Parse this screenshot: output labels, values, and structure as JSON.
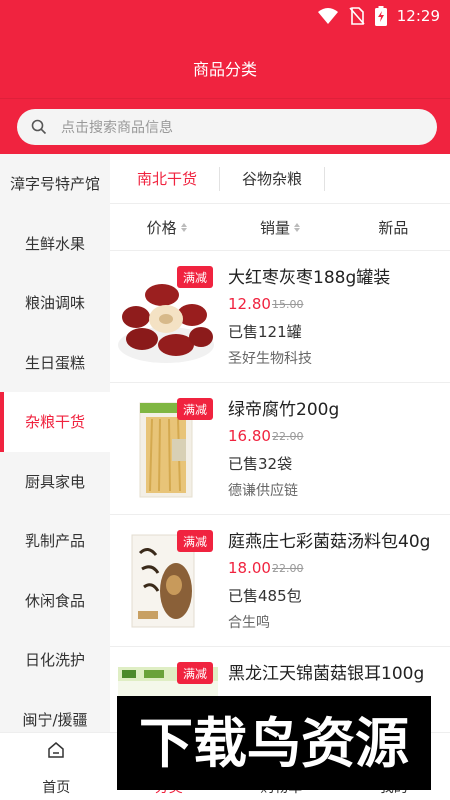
{
  "status_bar": {
    "time": "12:29"
  },
  "header": {
    "title": "商品分类"
  },
  "search": {
    "placeholder": "点击搜索商品信息"
  },
  "sidebar": {
    "items": [
      {
        "label": "漳字号特产馆"
      },
      {
        "label": "生鲜水果"
      },
      {
        "label": "粮油调味"
      },
      {
        "label": "生日蛋糕"
      },
      {
        "label": "杂粮干货",
        "active": true
      },
      {
        "label": "厨具家电"
      },
      {
        "label": "乳制产品"
      },
      {
        "label": "休闲食品"
      },
      {
        "label": "日化洗护"
      },
      {
        "label": "闽宁/援疆"
      }
    ]
  },
  "subtabs": [
    {
      "label": "南北干货",
      "active": true
    },
    {
      "label": "谷物杂粮"
    }
  ],
  "sort": {
    "price": "价格",
    "sales": "销量",
    "new": "新品"
  },
  "products": [
    {
      "badge": "满减",
      "name": "大红枣灰枣188g罐装",
      "price": "12.80",
      "old_price": "15.00",
      "sold": "已售121罐",
      "shop": "圣好生物科技"
    },
    {
      "badge": "满减",
      "name": "绿帝腐竹200g",
      "price": "16.80",
      "old_price": "22.00",
      "sold": "已售32袋",
      "shop": "德谦供应链"
    },
    {
      "badge": "满减",
      "name": "庭燕庄七彩菌菇汤料包40g",
      "price": "18.00",
      "old_price": "22.00",
      "sold": "已售485包",
      "shop": "合生鸣"
    },
    {
      "badge": "满减",
      "name": "黑龙江天锦菌菇银耳100g",
      "price": "",
      "old_price": "",
      "sold": "",
      "shop": ""
    }
  ],
  "bottom_nav": {
    "home": "首页",
    "category": "分类",
    "cart": "购物车",
    "mine": "我的"
  },
  "watermark": {
    "text": "下载鸟资源"
  },
  "colors": {
    "accent": "#f0233f"
  }
}
